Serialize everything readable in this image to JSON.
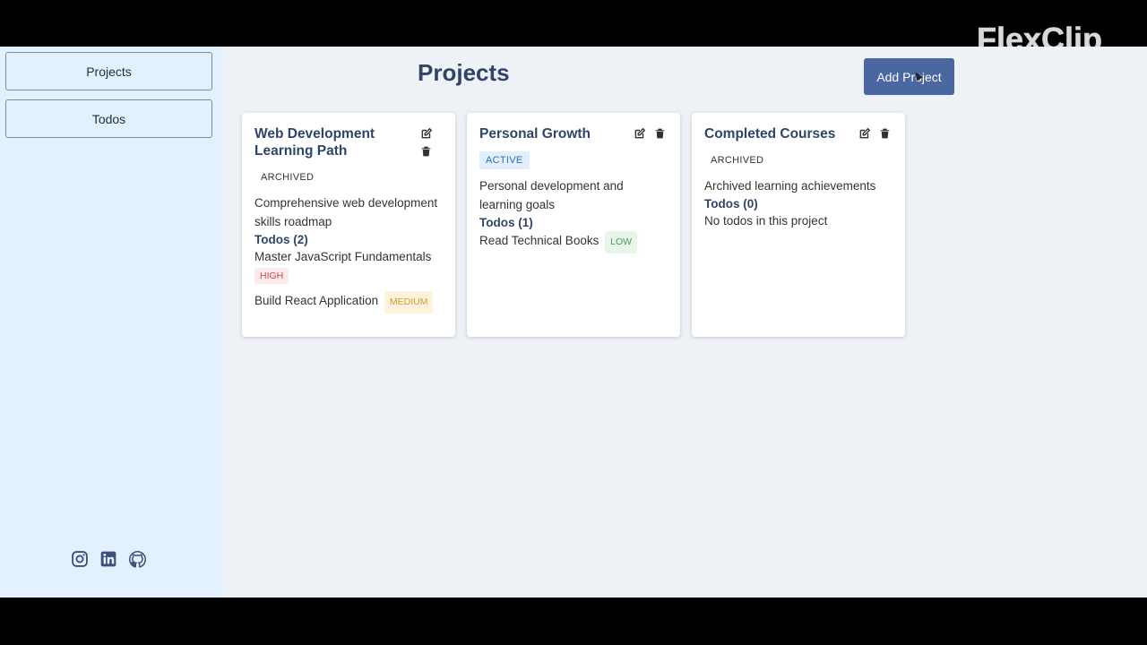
{
  "watermark": {
    "text": "FlexClip"
  },
  "sidebar": {
    "items": [
      {
        "label": "Projects"
      },
      {
        "label": "Todos"
      }
    ],
    "social": [
      "instagram-icon",
      "linkedin-icon",
      "github-icon"
    ]
  },
  "header": {
    "title": "Projects",
    "add_button": "Add Project"
  },
  "colors": {
    "accent": "#4a67a1",
    "title": "#2f4568",
    "sidebar_bg": "#e3f0fd",
    "page_bg": "#eef2f7"
  },
  "projects": [
    {
      "title": "Web Development Learning Path",
      "status": "ARCHIVED",
      "description": "Comprehensive web development skills roadmap",
      "todos_label": "Todos (2)",
      "todos": [
        {
          "text": "Master JavaScript Fundamentals",
          "priority": "HIGH"
        },
        {
          "text": "Build React Application",
          "priority": "MEDIUM"
        }
      ]
    },
    {
      "title": "Personal Growth",
      "status": "ACTIVE",
      "description": "Personal development and learning goals",
      "todos_label": "Todos (1)",
      "todos": [
        {
          "text": "Read Technical Books",
          "priority": "LOW"
        }
      ]
    },
    {
      "title": "Completed Courses",
      "status": "ARCHIVED",
      "description": "Archived learning achievements",
      "todos_label": "Todos (0)",
      "empty_text": "No todos in this project"
    }
  ]
}
